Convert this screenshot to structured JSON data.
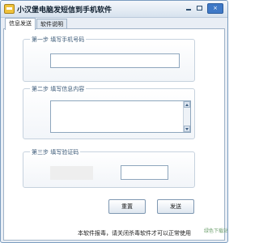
{
  "window": {
    "title": "小汉堡电脑发短信到手机软件"
  },
  "tabs": [
    {
      "label": "信息发送",
      "active": true
    },
    {
      "label": "软件说明",
      "active": false
    }
  ],
  "form": {
    "step1": {
      "title": "第一步  填写手机号码",
      "value": ""
    },
    "step2": {
      "title": "第二步  填写信息内容",
      "value": ""
    },
    "step3": {
      "title": "第三步  填写验证码",
      "value": ""
    }
  },
  "buttons": {
    "reset": "重置",
    "send": "发送"
  },
  "footer": {
    "note": "本软件报毒，请关闭杀毒软件才可以正常使用",
    "watermark": "绿色下载站\ngreenxf.com"
  },
  "icons": {
    "app": "app-logo-icon",
    "minimize": "minimize-icon",
    "maximize": "maximize-icon",
    "close": "close-icon",
    "scroll_up": "chevron-up-icon",
    "scroll_down": "chevron-down-icon"
  },
  "colors": {
    "accent": "#3f79c7",
    "border": "#7a9cc0",
    "title_gradient_top": "#f4f7fb",
    "title_gradient_bottom": "#d7e2ee",
    "panel_background": "#ffffff",
    "group_title": "#3b5a78"
  }
}
